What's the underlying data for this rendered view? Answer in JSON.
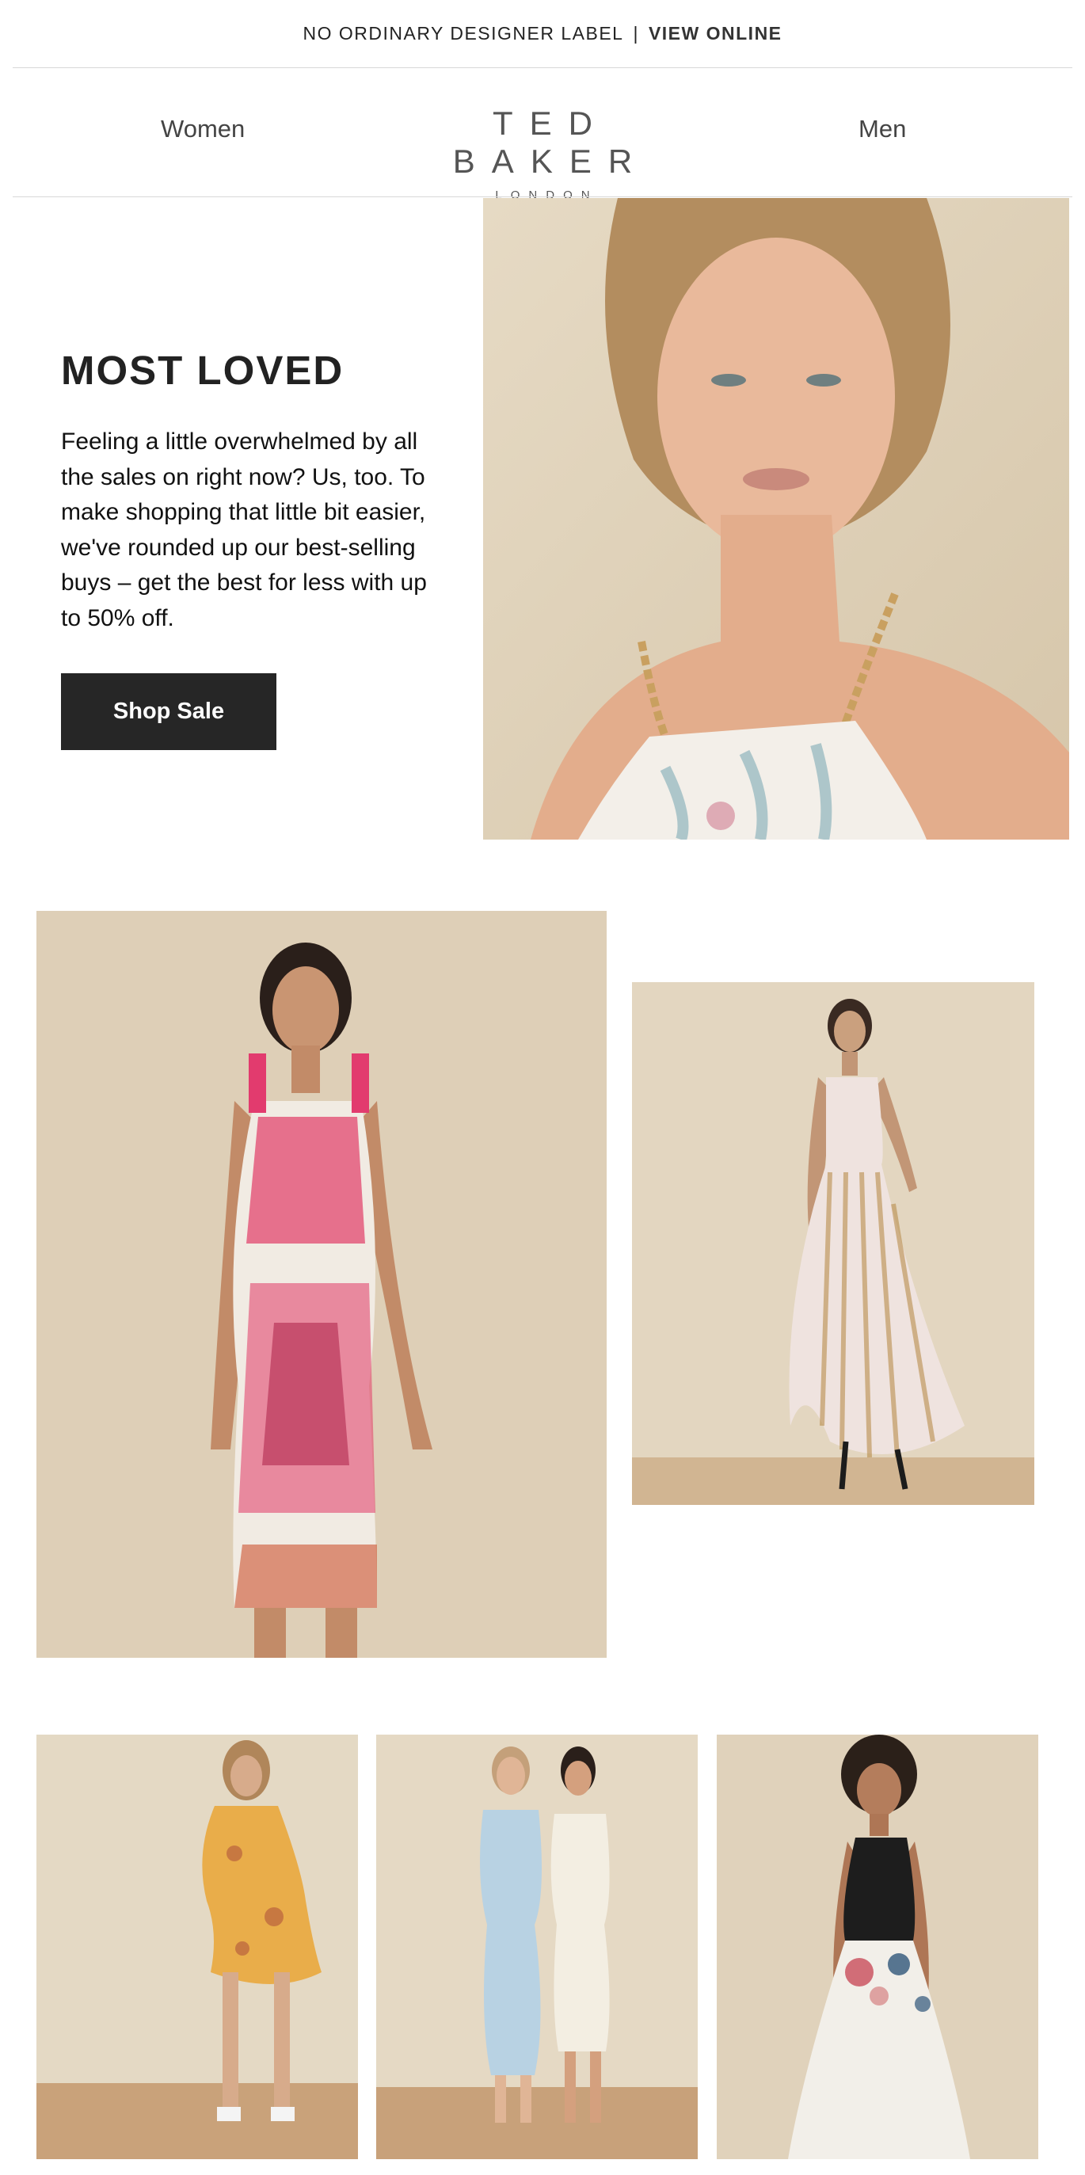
{
  "top_banner": {
    "tagline": "NO ORDINARY DESIGNER LABEL",
    "separator": "|",
    "view_online": "VIEW ONLINE"
  },
  "nav": {
    "women": "Women",
    "men": "Men"
  },
  "brand": {
    "name": "TED BAKER",
    "sub": "LONDON"
  },
  "hero": {
    "title": "MOST LOVED",
    "copy": "Feeling a little overwhelmed by all the sales on right now? Us, too. To make shopping that little bit easier, we've rounded up our best-selling buys – get the best for less with up to 50% off.",
    "button": "Shop Sale"
  },
  "colors": {
    "background": "#ffffff",
    "button_bg": "#262626",
    "button_text": "#ffffff",
    "studio_backdrop": "#e2d6c1",
    "floor": "#c9a47e"
  },
  "images": [
    {
      "name": "model-portrait-white-floral-halter-dress"
    },
    {
      "name": "model-pink-floral-bodycon-dress"
    },
    {
      "name": "model-pleated-print-maxi-dress"
    },
    {
      "name": "model-yellow-floral-dress"
    },
    {
      "name": "models-blue-and-white-wrap-dresses"
    },
    {
      "name": "model-black-floral-skater-dress"
    }
  ]
}
